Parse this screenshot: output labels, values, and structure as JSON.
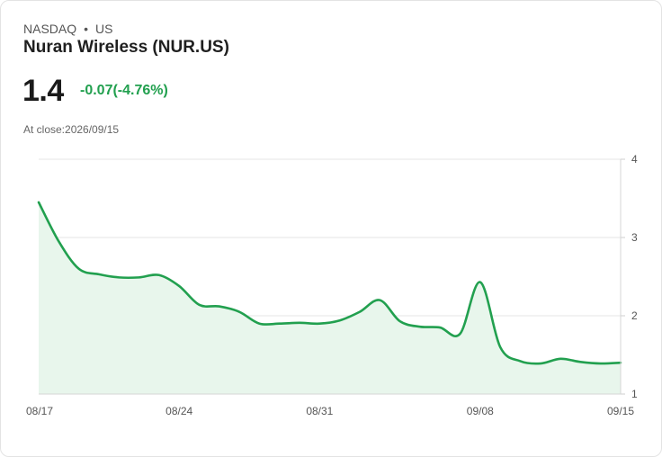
{
  "header": {
    "exchange": "NASDAQ",
    "separator": "•",
    "market": "US",
    "name": "Nuran Wireless (NUR.US)",
    "price": "1.4",
    "change": "-0.07(-4.76%)",
    "at_close_label": "At close:",
    "at_close_date": "2026/09/15"
  },
  "colors": {
    "line": "#22a04f",
    "area": "#e8f6ec",
    "change": "#22a04f",
    "grid": "#e5e5e5"
  },
  "chart_data": {
    "type": "area",
    "x": [
      "08/17",
      "08/18",
      "08/19",
      "08/20",
      "08/21",
      "08/22",
      "08/23",
      "08/24",
      "08/25",
      "08/26",
      "08/27",
      "08/28",
      "08/29",
      "08/30",
      "08/31",
      "09/01",
      "09/02",
      "09/03",
      "09/04",
      "09/05",
      "09/06",
      "09/07",
      "09/08",
      "09/09",
      "09/10",
      "09/11",
      "09/12",
      "09/13",
      "09/14",
      "09/15"
    ],
    "values": [
      3.45,
      2.95,
      2.6,
      2.53,
      2.49,
      2.49,
      2.52,
      2.38,
      2.14,
      2.12,
      2.05,
      1.9,
      1.9,
      1.91,
      1.9,
      1.94,
      2.05,
      2.2,
      1.93,
      1.86,
      1.85,
      1.77,
      2.43,
      1.6,
      1.42,
      1.39,
      1.45,
      1.41,
      1.39,
      1.4
    ],
    "xticks": [
      "08/17",
      "08/24",
      "08/31",
      "09/08",
      "09/15"
    ],
    "yticks": [
      1,
      2,
      3,
      4
    ],
    "ylim": [
      1,
      4
    ],
    "grid": true
  }
}
